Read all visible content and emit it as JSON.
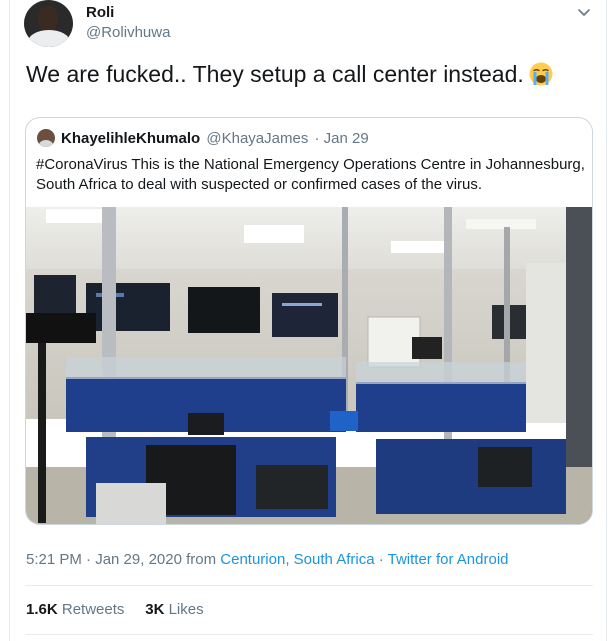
{
  "author": {
    "display_name": "Roli",
    "handle": "@Rolivhuwa"
  },
  "tweet": {
    "text": "We are fucked.. They setup a call center instead.",
    "emoji": "loudly-crying-face"
  },
  "quoted_tweet": {
    "display_name": "KhayelihleKhumalo",
    "handle": "@KhayaJames",
    "date": "· Jan 29",
    "text": "#CoronaVirus This is the National Emergency Operations Centre in Johannesburg, South Africa to deal with suspected or confirmed cases of the virus."
  },
  "meta": {
    "time_date": "5:21 PM · Jan 29, 2020 from ",
    "location": "Centurion, South Africa",
    "separator": " · ",
    "source": "Twitter for Android"
  },
  "stats": {
    "retweets_count": "1.6K",
    "retweets_label": "Retweets",
    "likes_count": "3K",
    "likes_label": "Likes"
  },
  "colors": {
    "link": "#1b95e0",
    "secondary_text": "#657786",
    "primary_text": "#14171a",
    "border": "#ccd6dd"
  }
}
